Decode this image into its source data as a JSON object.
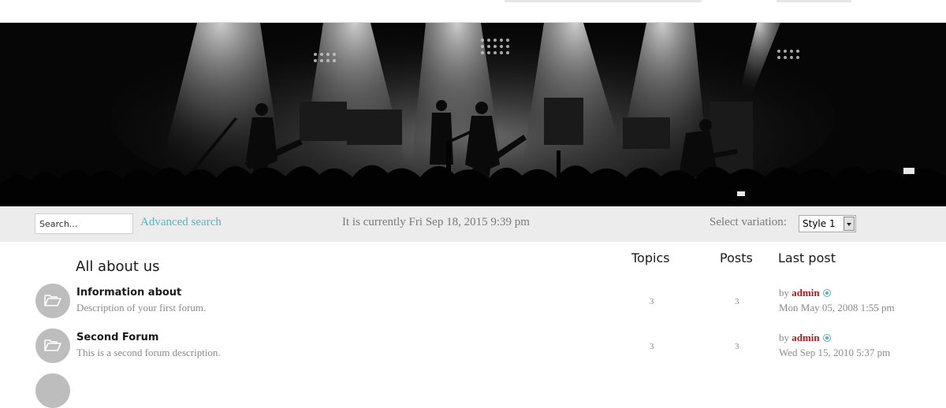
{
  "toolbar": {
    "search_placeholder": "Search...",
    "advanced_search": "Advanced search",
    "current_time": "It is currently Fri Sep 18, 2015 9:39 pm",
    "variation_label": "Select variation:",
    "variation_value": "Style 1"
  },
  "category": {
    "title": "All about us",
    "col_topics": "Topics",
    "col_posts": "Posts",
    "col_lastpost": "Last post"
  },
  "forums": [
    {
      "title": "Information about",
      "description": "Description of your first forum.",
      "topics": "3",
      "posts": "3",
      "by": "by",
      "author": "admin",
      "date": "Mon May 05, 2008 1:55 pm",
      "icon": "folder-icon"
    },
    {
      "title": "Second Forum",
      "description": "This is a second forum description.",
      "topics": "3",
      "posts": "3",
      "by": "by",
      "author": "admin",
      "date": "Wed Sep 15, 2010 5:37 pm",
      "icon": "folder-icon"
    }
  ],
  "colors": {
    "accent": "#4fb6c4",
    "author": "#b11e1e",
    "toolbar_bg": "#ececec",
    "icon_circle": "#bdbdbd"
  }
}
